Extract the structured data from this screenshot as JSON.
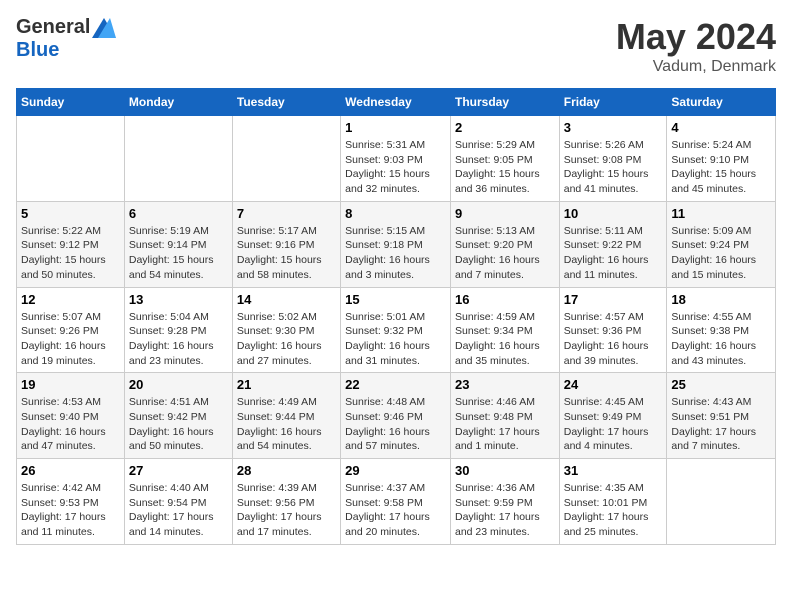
{
  "header": {
    "logo_general": "General",
    "logo_blue": "Blue",
    "month_year": "May 2024",
    "location": "Vadum, Denmark"
  },
  "days_of_week": [
    "Sunday",
    "Monday",
    "Tuesday",
    "Wednesday",
    "Thursday",
    "Friday",
    "Saturday"
  ],
  "weeks": [
    [
      {
        "day": "",
        "info": ""
      },
      {
        "day": "",
        "info": ""
      },
      {
        "day": "",
        "info": ""
      },
      {
        "day": "1",
        "info": "Sunrise: 5:31 AM\nSunset: 9:03 PM\nDaylight: 15 hours and 32 minutes."
      },
      {
        "day": "2",
        "info": "Sunrise: 5:29 AM\nSunset: 9:05 PM\nDaylight: 15 hours and 36 minutes."
      },
      {
        "day": "3",
        "info": "Sunrise: 5:26 AM\nSunset: 9:08 PM\nDaylight: 15 hours and 41 minutes."
      },
      {
        "day": "4",
        "info": "Sunrise: 5:24 AM\nSunset: 9:10 PM\nDaylight: 15 hours and 45 minutes."
      }
    ],
    [
      {
        "day": "5",
        "info": "Sunrise: 5:22 AM\nSunset: 9:12 PM\nDaylight: 15 hours and 50 minutes."
      },
      {
        "day": "6",
        "info": "Sunrise: 5:19 AM\nSunset: 9:14 PM\nDaylight: 15 hours and 54 minutes."
      },
      {
        "day": "7",
        "info": "Sunrise: 5:17 AM\nSunset: 9:16 PM\nDaylight: 15 hours and 58 minutes."
      },
      {
        "day": "8",
        "info": "Sunrise: 5:15 AM\nSunset: 9:18 PM\nDaylight: 16 hours and 3 minutes."
      },
      {
        "day": "9",
        "info": "Sunrise: 5:13 AM\nSunset: 9:20 PM\nDaylight: 16 hours and 7 minutes."
      },
      {
        "day": "10",
        "info": "Sunrise: 5:11 AM\nSunset: 9:22 PM\nDaylight: 16 hours and 11 minutes."
      },
      {
        "day": "11",
        "info": "Sunrise: 5:09 AM\nSunset: 9:24 PM\nDaylight: 16 hours and 15 minutes."
      }
    ],
    [
      {
        "day": "12",
        "info": "Sunrise: 5:07 AM\nSunset: 9:26 PM\nDaylight: 16 hours and 19 minutes."
      },
      {
        "day": "13",
        "info": "Sunrise: 5:04 AM\nSunset: 9:28 PM\nDaylight: 16 hours and 23 minutes."
      },
      {
        "day": "14",
        "info": "Sunrise: 5:02 AM\nSunset: 9:30 PM\nDaylight: 16 hours and 27 minutes."
      },
      {
        "day": "15",
        "info": "Sunrise: 5:01 AM\nSunset: 9:32 PM\nDaylight: 16 hours and 31 minutes."
      },
      {
        "day": "16",
        "info": "Sunrise: 4:59 AM\nSunset: 9:34 PM\nDaylight: 16 hours and 35 minutes."
      },
      {
        "day": "17",
        "info": "Sunrise: 4:57 AM\nSunset: 9:36 PM\nDaylight: 16 hours and 39 minutes."
      },
      {
        "day": "18",
        "info": "Sunrise: 4:55 AM\nSunset: 9:38 PM\nDaylight: 16 hours and 43 minutes."
      }
    ],
    [
      {
        "day": "19",
        "info": "Sunrise: 4:53 AM\nSunset: 9:40 PM\nDaylight: 16 hours and 47 minutes."
      },
      {
        "day": "20",
        "info": "Sunrise: 4:51 AM\nSunset: 9:42 PM\nDaylight: 16 hours and 50 minutes."
      },
      {
        "day": "21",
        "info": "Sunrise: 4:49 AM\nSunset: 9:44 PM\nDaylight: 16 hours and 54 minutes."
      },
      {
        "day": "22",
        "info": "Sunrise: 4:48 AM\nSunset: 9:46 PM\nDaylight: 16 hours and 57 minutes."
      },
      {
        "day": "23",
        "info": "Sunrise: 4:46 AM\nSunset: 9:48 PM\nDaylight: 17 hours and 1 minute."
      },
      {
        "day": "24",
        "info": "Sunrise: 4:45 AM\nSunset: 9:49 PM\nDaylight: 17 hours and 4 minutes."
      },
      {
        "day": "25",
        "info": "Sunrise: 4:43 AM\nSunset: 9:51 PM\nDaylight: 17 hours and 7 minutes."
      }
    ],
    [
      {
        "day": "26",
        "info": "Sunrise: 4:42 AM\nSunset: 9:53 PM\nDaylight: 17 hours and 11 minutes."
      },
      {
        "day": "27",
        "info": "Sunrise: 4:40 AM\nSunset: 9:54 PM\nDaylight: 17 hours and 14 minutes."
      },
      {
        "day": "28",
        "info": "Sunrise: 4:39 AM\nSunset: 9:56 PM\nDaylight: 17 hours and 17 minutes."
      },
      {
        "day": "29",
        "info": "Sunrise: 4:37 AM\nSunset: 9:58 PM\nDaylight: 17 hours and 20 minutes."
      },
      {
        "day": "30",
        "info": "Sunrise: 4:36 AM\nSunset: 9:59 PM\nDaylight: 17 hours and 23 minutes."
      },
      {
        "day": "31",
        "info": "Sunrise: 4:35 AM\nSunset: 10:01 PM\nDaylight: 17 hours and 25 minutes."
      },
      {
        "day": "",
        "info": ""
      }
    ]
  ]
}
